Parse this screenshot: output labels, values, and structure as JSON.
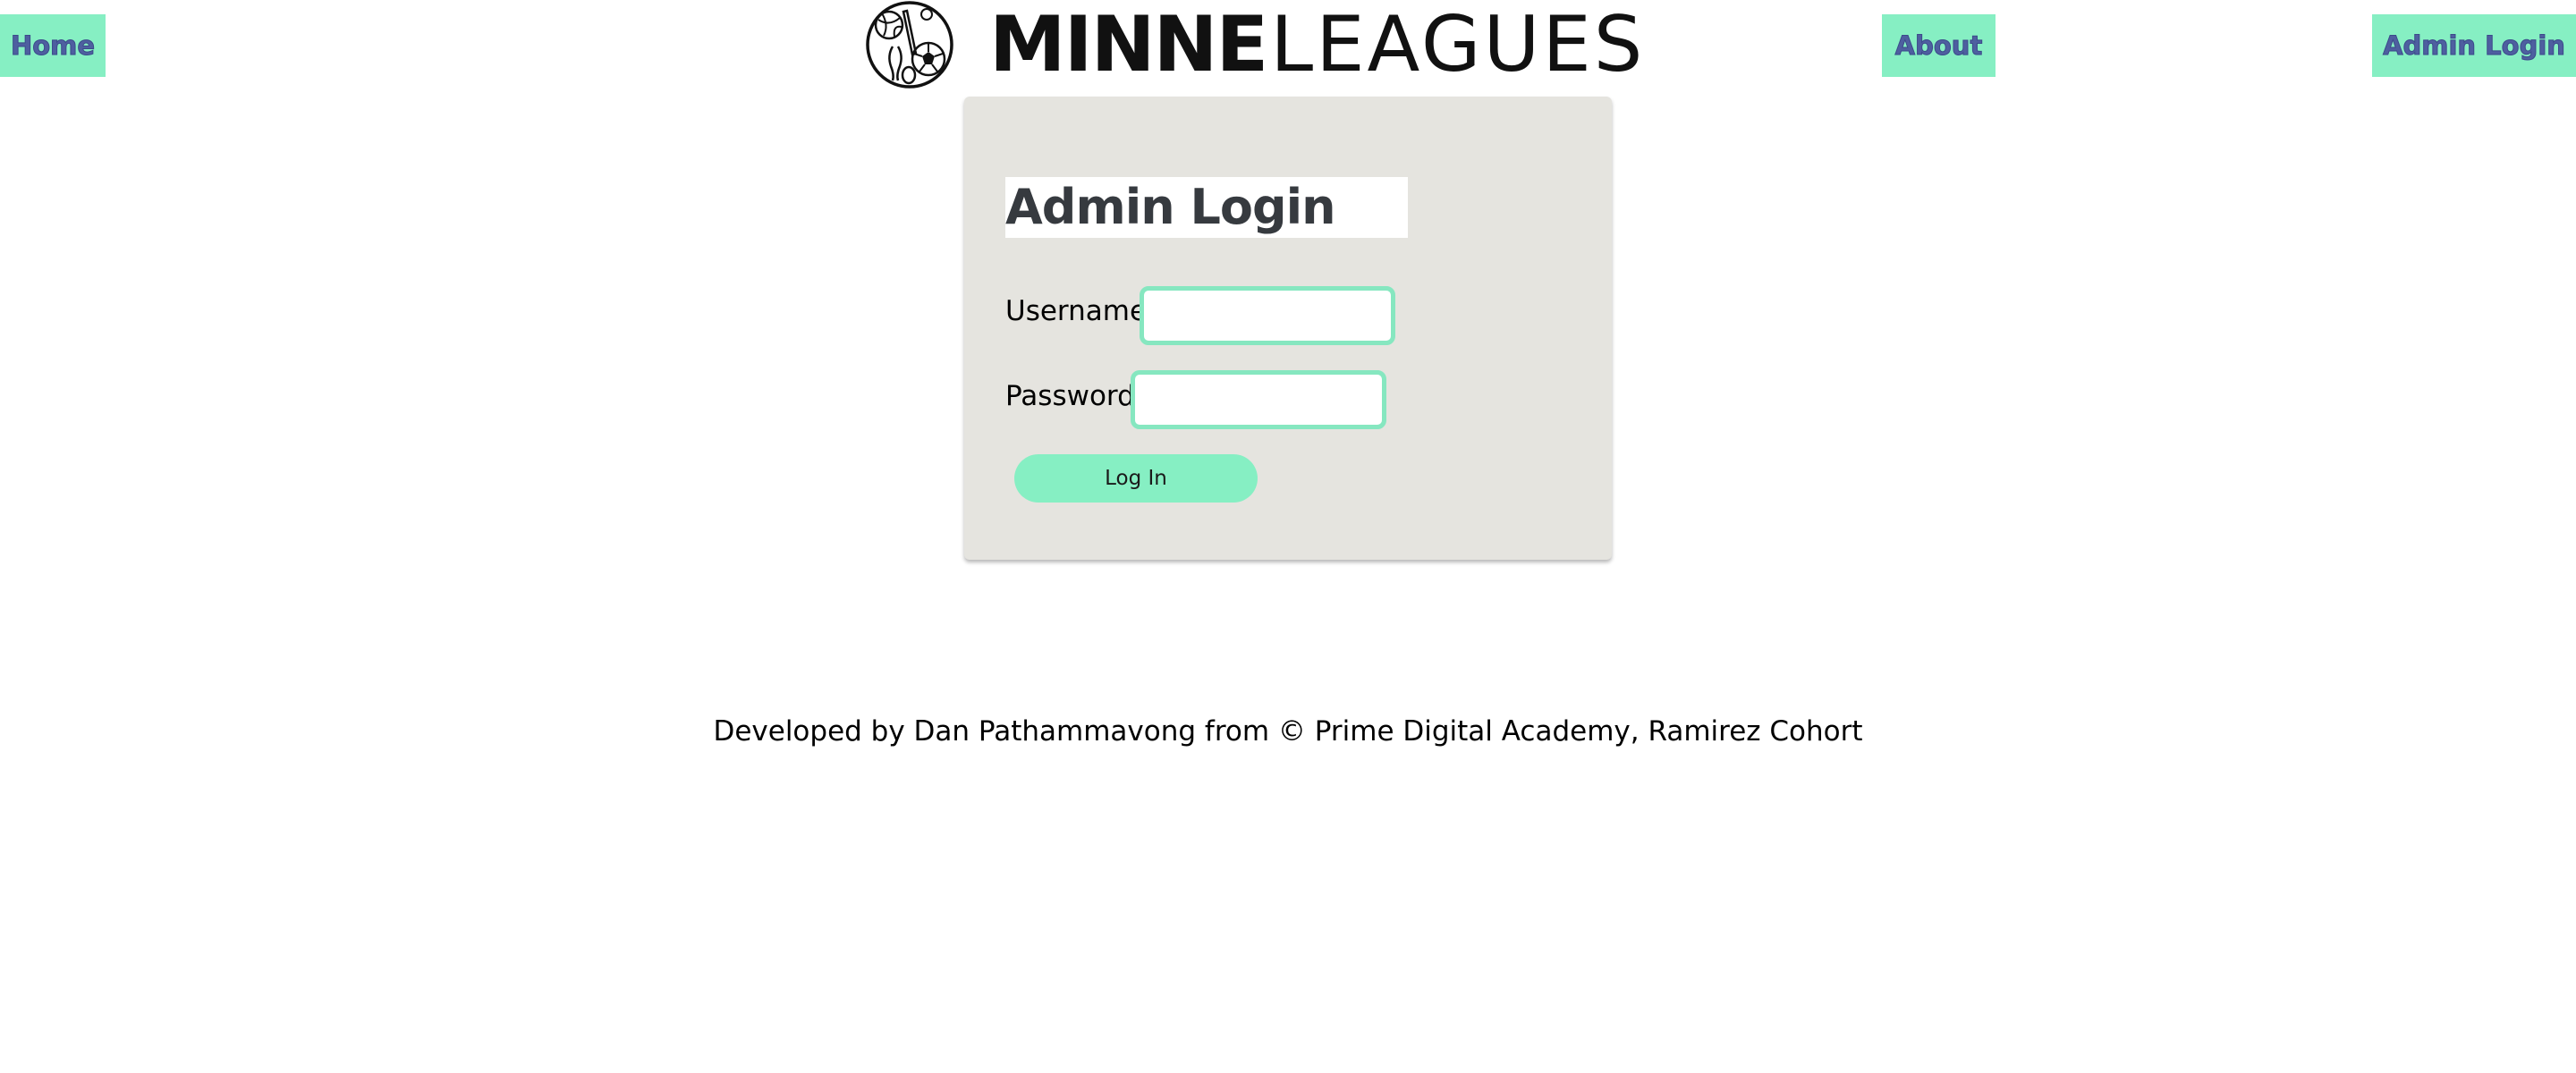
{
  "nav": {
    "home_label": "Home",
    "about_label": "About",
    "admin_login_label": "Admin Login"
  },
  "brand": {
    "name_bold": "MINNE",
    "name_light": "LEAGUES",
    "logo_icon": "sports-balls-logo-icon"
  },
  "login": {
    "title": "Admin Login",
    "username_label": "Username:",
    "username_value": "",
    "password_label": "Password:",
    "password_value": "",
    "submit_label": "Log In"
  },
  "footer": {
    "text": "Developed by Dan Pathammavong from © Prime Digital Academy, Ramirez Cohort"
  },
  "colors": {
    "accent": "#86efc3",
    "nav_text": "#4e5fa0",
    "card_bg": "#e5e4df",
    "input_border": "#86e7c0",
    "title_text": "#363a3f"
  }
}
